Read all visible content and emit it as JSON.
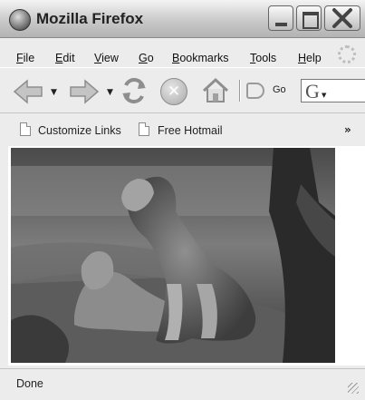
{
  "window": {
    "title": "Mozilla Firefox",
    "controls": [
      "minimize",
      "maximize",
      "close"
    ]
  },
  "menu": {
    "items": [
      {
        "label": "File"
      },
      {
        "label": "Edit"
      },
      {
        "label": "View"
      },
      {
        "label": "Go"
      },
      {
        "label": "Bookmarks"
      },
      {
        "label": "Tools"
      },
      {
        "label": "Help"
      }
    ]
  },
  "toolbar": {
    "icons": [
      "back-arrow-icon",
      "forward-arrow-icon",
      "reload-icon",
      "stop-icon",
      "home-icon",
      "go-icon"
    ],
    "go_label": "Go",
    "search_engine_glyph": "G"
  },
  "bookmarks": {
    "items": [
      {
        "label": "Customize Links"
      },
      {
        "label": "Free Hotmail"
      }
    ],
    "overflow_glyph": "»"
  },
  "content": {
    "image_subject": "lioness-photo"
  },
  "status": {
    "text": "Done"
  },
  "colors": {
    "chrome": "#ececec",
    "titlebar_top": "#f4f4f4",
    "titlebar_bottom": "#b3b3b3",
    "icon_gray": "#9a9a9a"
  }
}
